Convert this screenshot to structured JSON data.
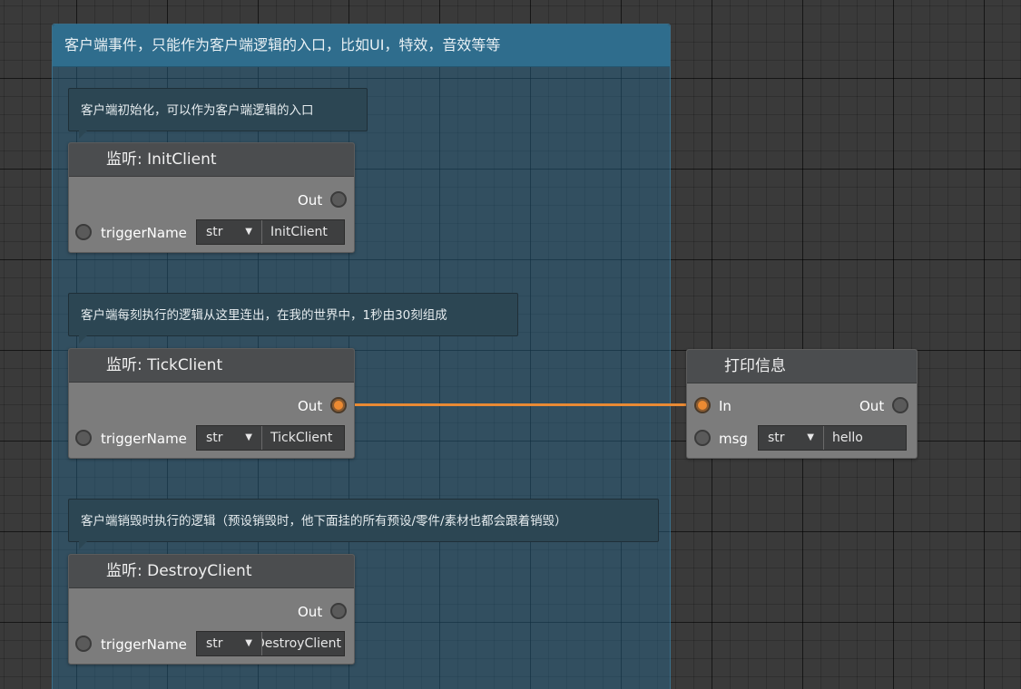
{
  "group": {
    "title": "客户端事件，只能作为客户端逻辑的入口，比如UI，特效，音效等等"
  },
  "comments": [
    {
      "text": "客户端初始化，可以作为客户端逻辑的入口"
    },
    {
      "text": "客户端每刻执行的逻辑从这里连出，在我的世界中，1秒由30刻组成"
    },
    {
      "text": "客户端销毁时执行的逻辑（预设销毁时，他下面挂的所有预设/零件/素材也都会跟着销毁）"
    }
  ],
  "nodes": {
    "init": {
      "title": "监听: InitClient",
      "out_label": "Out",
      "param_label": "triggerName",
      "type": "str",
      "value": "InitClient"
    },
    "tick": {
      "title": "监听: TickClient",
      "out_label": "Out",
      "param_label": "triggerName",
      "type": "str",
      "value": "TickClient"
    },
    "destroy": {
      "title": "监听: DestroyClient",
      "out_label": "Out",
      "param_label": "triggerName",
      "type": "str",
      "value": "DestroyClient"
    },
    "print": {
      "title": "打印信息",
      "in_label": "In",
      "out_label": "Out",
      "param_label": "msg",
      "type": "str",
      "value": "hello"
    }
  },
  "colors": {
    "wire": "#e98a34",
    "active_pin": "#ec8a32",
    "group": "#2f6d8d"
  },
  "icons": {
    "dropdown": "▼"
  }
}
